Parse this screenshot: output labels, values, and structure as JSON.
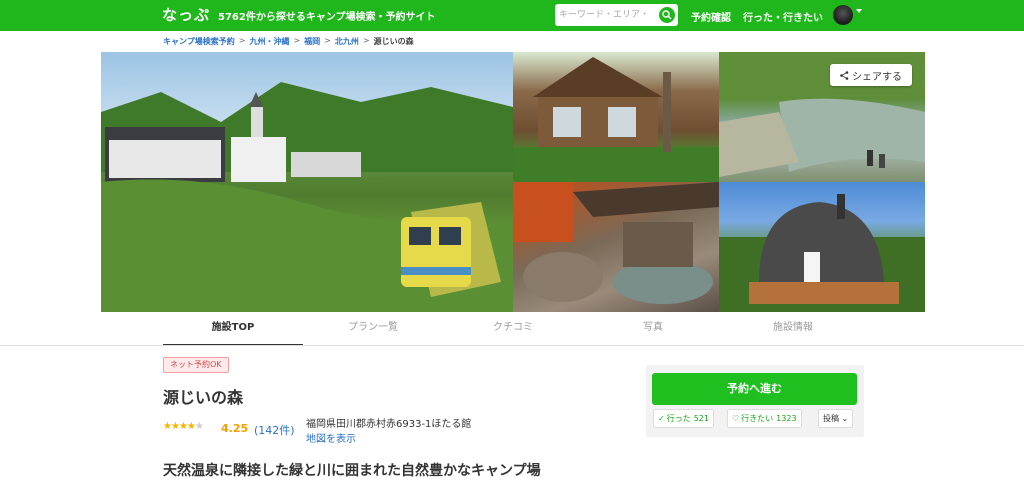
{
  "header": {
    "logo": "なっぷ",
    "tagline": "5762件から探せるキャンプ場検索・予約サイト",
    "search_placeholder": "キーワード・エリア・",
    "nav": [
      "予約確認",
      "行った・行きたい"
    ],
    "brand_color": "#1fb71b"
  },
  "breadcrumb": {
    "items": [
      "キャンプ場検索予約",
      "九州・沖縄",
      "福岡",
      "北九州"
    ],
    "current": "源じいの森",
    "separator": ">"
  },
  "gallery": {
    "share_label": "シェアする"
  },
  "tabs": [
    "施設TOP",
    "プラン一覧",
    "クチコミ",
    "写真",
    "施設情報"
  ],
  "facility": {
    "badge": "ネット予約OK",
    "name": "源じいの森",
    "rating": "4.25",
    "stars_filled": 4,
    "reviews": "(142件)",
    "address": "福岡県田川郡赤村赤6933-1ほたる館",
    "map_link": "地図を表示",
    "headline": "天然温泉に隣接した緑と川に囲まれた自然豊かなキャンプ場"
  },
  "booking": {
    "reserve_label": "予約へ進む",
    "went_label": "行った",
    "went_count": "521",
    "want_label": "行きたい",
    "want_count": "1323",
    "post_label": "投稿"
  }
}
